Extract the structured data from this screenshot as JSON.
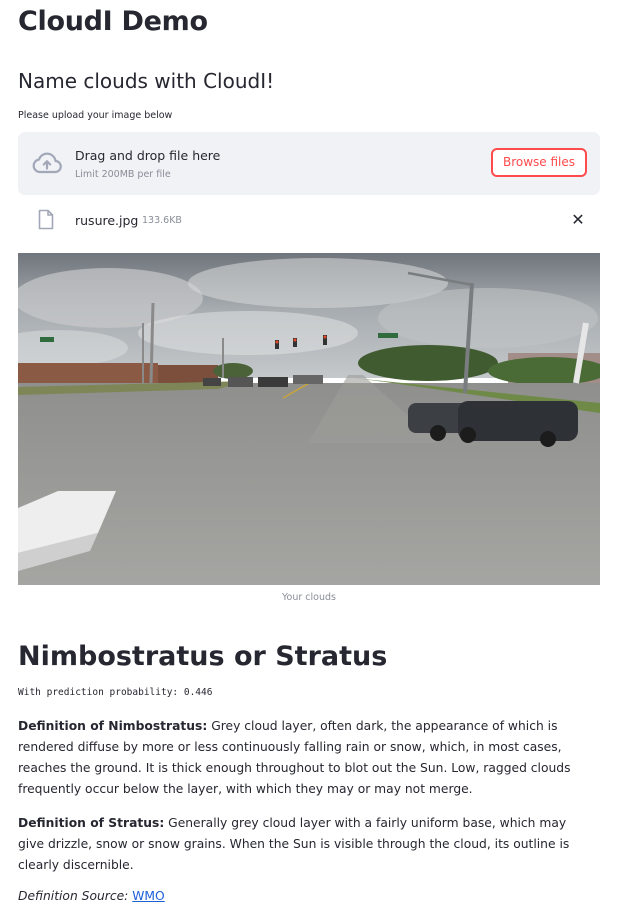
{
  "page": {
    "title": "CloudI Demo",
    "subtitle": "Name clouds with CloudI!"
  },
  "uploader": {
    "label": "Please upload your image below",
    "drag_text": "Drag and drop file here",
    "limit_text": "Limit 200MB per file",
    "browse_label": "Browse files",
    "icon": "cloud-upload-icon",
    "accent_color": "#ff4b4b"
  },
  "file": {
    "name": "rusure.jpg",
    "size": "133.6KB",
    "icon": "file-icon",
    "remove_symbol": "✕"
  },
  "image": {
    "caption": "Your clouds"
  },
  "result": {
    "title": "Nimbostratus or Stratus",
    "probability_text": "With prediction probability: 0.446",
    "def1_label": "Definition of Nimbostratus:",
    "def1_text": " Grey cloud layer, often dark, the appearance of which is rendered diffuse by more or less continuously falling rain or snow, which, in most cases, reaches the ground. It is thick enough throughout to blot out the Sun. Low, ragged clouds frequently occur below the layer, with which they may or may not merge.",
    "def2_label": "Definition of Stratus:",
    "def2_text": " Generally grey cloud layer with a fairly uniform base, which may give drizzle, snow or snow grains. When the Sun is visible through the cloud, its outline is clearly discernible.",
    "source_label": "Definition Source: ",
    "source_link": "WMO"
  }
}
